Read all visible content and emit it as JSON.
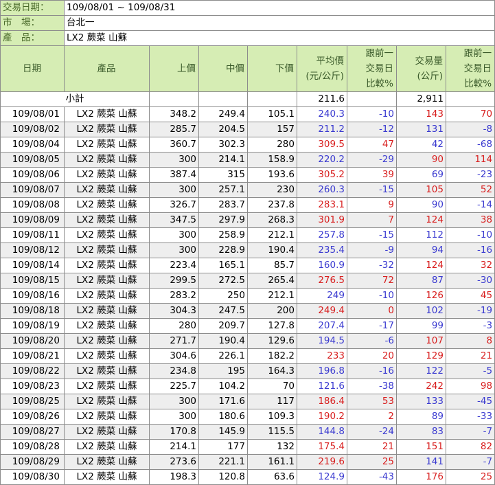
{
  "info": {
    "date_label": "交易日期：",
    "date_value": "109/08/01 ~ 109/08/31",
    "market_label": "市　場：",
    "market_value": "台北一",
    "product_label": "產　品：",
    "product_value": "LX2 蕨菜 山蘇"
  },
  "headers": {
    "date": "日期",
    "product": "產品",
    "high": "上價",
    "mid": "中價",
    "low": "下價",
    "avg": [
      "平均價",
      "(元/公斤)"
    ],
    "avg_change": [
      "跟前一",
      "交易日",
      "比較%"
    ],
    "volume": [
      "交易量",
      "(公斤)"
    ],
    "vol_change": [
      "跟前一",
      "交易日",
      "比較%"
    ]
  },
  "subtotal": {
    "label": "小計",
    "avg": "211.6",
    "volume": "2,911"
  },
  "colors": {
    "up": "#d81e1e",
    "down": "#3a3ad0",
    "header_bg": "#d6edb4",
    "alt_row": "#eeeeee"
  },
  "rows": [
    {
      "date": "109/08/01",
      "product": "LX2 蕨菜 山蘇",
      "high": "348.2",
      "mid": "249.4",
      "low": "105.1",
      "avg": "240.3",
      "avg_chg": "-10",
      "vol": "143",
      "vol_chg": "70"
    },
    {
      "date": "109/08/02",
      "product": "LX2 蕨菜 山蘇",
      "high": "285.7",
      "mid": "204.5",
      "low": "157",
      "avg": "211.2",
      "avg_chg": "-12",
      "vol": "131",
      "vol_chg": "-8"
    },
    {
      "date": "109/08/04",
      "product": "LX2 蕨菜 山蘇",
      "high": "360.7",
      "mid": "302.3",
      "low": "280",
      "avg": "309.5",
      "avg_chg": "47",
      "vol": "42",
      "vol_chg": "-68"
    },
    {
      "date": "109/08/05",
      "product": "LX2 蕨菜 山蘇",
      "high": "300",
      "mid": "214.1",
      "low": "158.9",
      "avg": "220.2",
      "avg_chg": "-29",
      "vol": "90",
      "vol_chg": "114"
    },
    {
      "date": "109/08/06",
      "product": "LX2 蕨菜 山蘇",
      "high": "387.4",
      "mid": "315",
      "low": "193.6",
      "avg": "305.2",
      "avg_chg": "39",
      "vol": "69",
      "vol_chg": "-23"
    },
    {
      "date": "109/08/07",
      "product": "LX2 蕨菜 山蘇",
      "high": "300",
      "mid": "257.1",
      "low": "230",
      "avg": "260.3",
      "avg_chg": "-15",
      "vol": "105",
      "vol_chg": "52"
    },
    {
      "date": "109/08/08",
      "product": "LX2 蕨菜 山蘇",
      "high": "326.7",
      "mid": "283.7",
      "low": "237.8",
      "avg": "283.1",
      "avg_chg": "9",
      "vol": "90",
      "vol_chg": "-14"
    },
    {
      "date": "109/08/09",
      "product": "LX2 蕨菜 山蘇",
      "high": "347.5",
      "mid": "297.9",
      "low": "268.3",
      "avg": "301.9",
      "avg_chg": "7",
      "vol": "124",
      "vol_chg": "38"
    },
    {
      "date": "109/08/11",
      "product": "LX2 蕨菜 山蘇",
      "high": "300",
      "mid": "258.9",
      "low": "212.1",
      "avg": "257.8",
      "avg_chg": "-15",
      "vol": "112",
      "vol_chg": "-10"
    },
    {
      "date": "109/08/12",
      "product": "LX2 蕨菜 山蘇",
      "high": "300",
      "mid": "228.9",
      "low": "190.4",
      "avg": "235.4",
      "avg_chg": "-9",
      "vol": "94",
      "vol_chg": "-16"
    },
    {
      "date": "109/08/14",
      "product": "LX2 蕨菜 山蘇",
      "high": "223.4",
      "mid": "165.1",
      "low": "85.7",
      "avg": "160.9",
      "avg_chg": "-32",
      "vol": "124",
      "vol_chg": "32"
    },
    {
      "date": "109/08/15",
      "product": "LX2 蕨菜 山蘇",
      "high": "299.5",
      "mid": "272.5",
      "low": "265.4",
      "avg": "276.5",
      "avg_chg": "72",
      "vol": "87",
      "vol_chg": "-30"
    },
    {
      "date": "109/08/16",
      "product": "LX2 蕨菜 山蘇",
      "high": "283.2",
      "mid": "250",
      "low": "212.1",
      "avg": "249",
      "avg_chg": "-10",
      "vol": "126",
      "vol_chg": "45"
    },
    {
      "date": "109/08/18",
      "product": "LX2 蕨菜 山蘇",
      "high": "304.3",
      "mid": "247.5",
      "low": "200",
      "avg": "249.4",
      "avg_chg": "0",
      "vol": "102",
      "vol_chg": "-19"
    },
    {
      "date": "109/08/19",
      "product": "LX2 蕨菜 山蘇",
      "high": "280",
      "mid": "209.7",
      "low": "127.8",
      "avg": "207.4",
      "avg_chg": "-17",
      "vol": "99",
      "vol_chg": "-3"
    },
    {
      "date": "109/08/20",
      "product": "LX2 蕨菜 山蘇",
      "high": "271.7",
      "mid": "190.4",
      "low": "129.6",
      "avg": "194.5",
      "avg_chg": "-6",
      "vol": "107",
      "vol_chg": "8"
    },
    {
      "date": "109/08/21",
      "product": "LX2 蕨菜 山蘇",
      "high": "304.6",
      "mid": "226.1",
      "low": "182.2",
      "avg": "233",
      "avg_chg": "20",
      "vol": "129",
      "vol_chg": "21"
    },
    {
      "date": "109/08/22",
      "product": "LX2 蕨菜 山蘇",
      "high": "234.8",
      "mid": "195",
      "low": "164.3",
      "avg": "196.8",
      "avg_chg": "-16",
      "vol": "122",
      "vol_chg": "-5"
    },
    {
      "date": "109/08/23",
      "product": "LX2 蕨菜 山蘇",
      "high": "225.7",
      "mid": "104.2",
      "low": "70",
      "avg": "121.6",
      "avg_chg": "-38",
      "vol": "242",
      "vol_chg": "98"
    },
    {
      "date": "109/08/25",
      "product": "LX2 蕨菜 山蘇",
      "high": "300",
      "mid": "171.6",
      "low": "117",
      "avg": "186.4",
      "avg_chg": "53",
      "vol": "133",
      "vol_chg": "-45"
    },
    {
      "date": "109/08/26",
      "product": "LX2 蕨菜 山蘇",
      "high": "300",
      "mid": "180.6",
      "low": "109.3",
      "avg": "190.2",
      "avg_chg": "2",
      "vol": "89",
      "vol_chg": "-33"
    },
    {
      "date": "109/08/27",
      "product": "LX2 蕨菜 山蘇",
      "high": "170.8",
      "mid": "145.9",
      "low": "115.5",
      "avg": "144.8",
      "avg_chg": "-24",
      "vol": "83",
      "vol_chg": "-7"
    },
    {
      "date": "109/08/28",
      "product": "LX2 蕨菜 山蘇",
      "high": "214.1",
      "mid": "177",
      "low": "132",
      "avg": "175.4",
      "avg_chg": "21",
      "vol": "151",
      "vol_chg": "82"
    },
    {
      "date": "109/08/29",
      "product": "LX2 蕨菜 山蘇",
      "high": "273.6",
      "mid": "221.1",
      "low": "161.1",
      "avg": "219.6",
      "avg_chg": "25",
      "vol": "141",
      "vol_chg": "-7"
    },
    {
      "date": "109/08/30",
      "product": "LX2 蕨菜 山蘇",
      "high": "198.3",
      "mid": "120.8",
      "low": "63.6",
      "avg": "124.9",
      "avg_chg": "-43",
      "vol": "176",
      "vol_chg": "25"
    }
  ]
}
